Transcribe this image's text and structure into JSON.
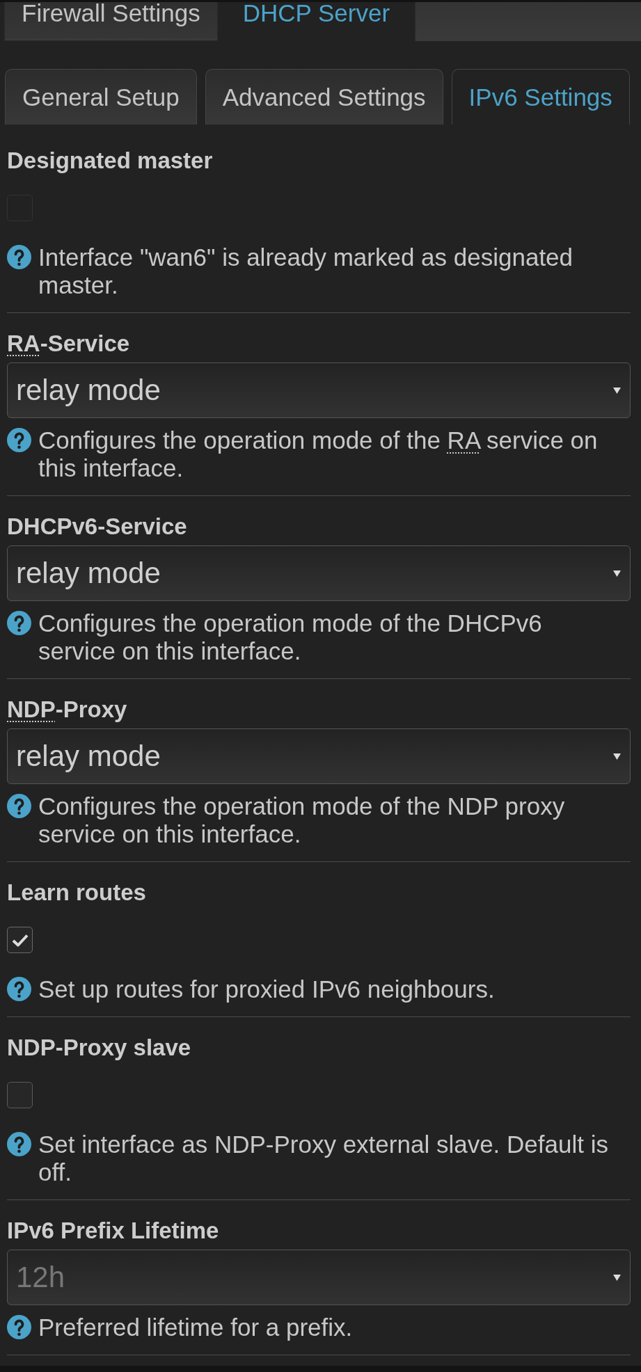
{
  "top_tabs": [
    {
      "label": "Firewall Settings",
      "selected": false
    },
    {
      "label": "DHCP Server",
      "selected": true
    }
  ],
  "sub_tabs": [
    {
      "label": "General Setup",
      "selected": false
    },
    {
      "label": "Advanced Settings",
      "selected": false
    },
    {
      "label": "IPv6 Settings",
      "selected": true
    }
  ],
  "sections": [
    {
      "kind": "checkbox",
      "label": [
        {
          "text": "Designated master",
          "abbr": false
        }
      ],
      "checked": false,
      "disabled": true,
      "help": [
        {
          "text": "Interface \"wan6\" is already marked as designated master.",
          "abbr": false
        }
      ]
    },
    {
      "kind": "select",
      "label": [
        {
          "text": "RA",
          "abbr": true
        },
        {
          "text": "-Service",
          "abbr": false
        }
      ],
      "value": "relay mode",
      "help": [
        {
          "text": "Configures the operation mode of the ",
          "abbr": false
        },
        {
          "text": "RA",
          "abbr": true
        },
        {
          "text": " service on this interface.",
          "abbr": false
        }
      ]
    },
    {
      "kind": "select",
      "label": [
        {
          "text": "DHCPv6-Service",
          "abbr": false
        }
      ],
      "value": "relay mode",
      "help": [
        {
          "text": "Configures the operation mode of the DHCPv6 service on this interface.",
          "abbr": false
        }
      ]
    },
    {
      "kind": "select",
      "label": [
        {
          "text": "NDP",
          "abbr": true
        },
        {
          "text": "-Proxy",
          "abbr": false
        }
      ],
      "value": "relay mode",
      "help": [
        {
          "text": "Configures the operation mode of the NDP proxy service on this interface.",
          "abbr": false
        }
      ]
    },
    {
      "kind": "checkbox",
      "label": [
        {
          "text": "Learn routes",
          "abbr": false
        }
      ],
      "checked": true,
      "disabled": false,
      "help": [
        {
          "text": "Set up routes for proxied IPv6 neighbours.",
          "abbr": false
        }
      ]
    },
    {
      "kind": "checkbox",
      "label": [
        {
          "text": "NDP-Proxy slave",
          "abbr": false
        }
      ],
      "checked": false,
      "disabled": false,
      "help": [
        {
          "text": "Set interface as NDP-Proxy external slave. Default is off.",
          "abbr": false
        }
      ]
    },
    {
      "kind": "select",
      "label": [
        {
          "text": "IPv6 Prefix Lifetime",
          "abbr": false
        }
      ],
      "placeholder": "12h",
      "help": [
        {
          "text": "Preferred lifetime for a prefix.",
          "abbr": false
        }
      ]
    }
  ]
}
